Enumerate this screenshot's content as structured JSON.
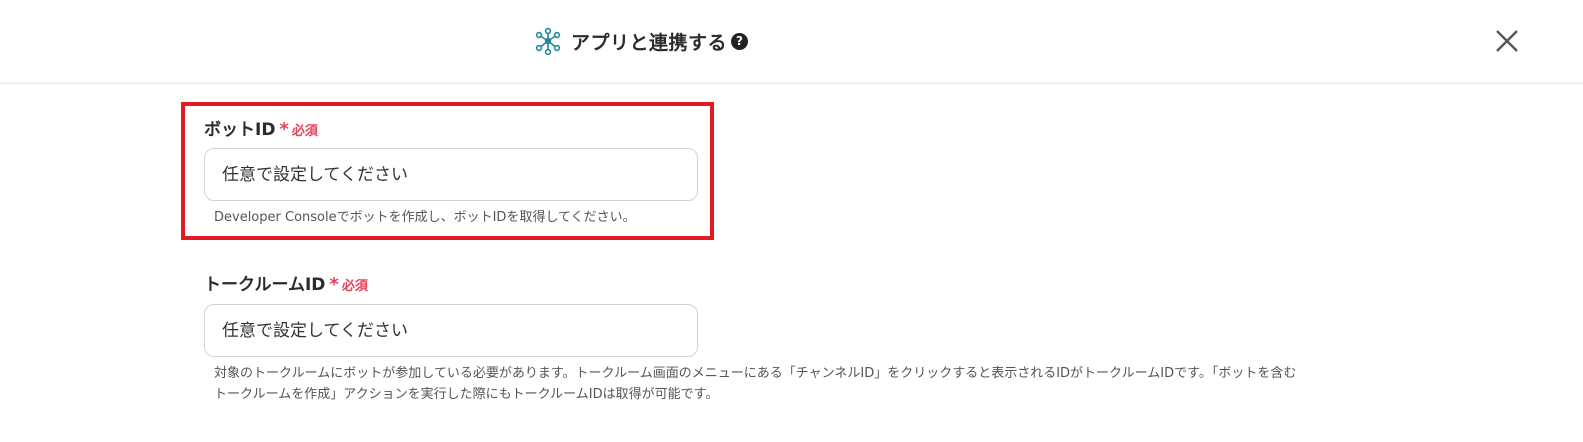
{
  "header": {
    "title": "アプリと連携する",
    "help_icon": "question-circle-icon",
    "close_icon": "close-x-icon"
  },
  "fields": [
    {
      "label": "ボットID",
      "required_mark": "*",
      "required_text": "必須",
      "placeholder": "任意で設定してください",
      "value": "",
      "help": "Developer Consoleでボットを作成し、ボットIDを取得してください。"
    },
    {
      "label": "トークルームID",
      "required_mark": "*",
      "required_text": "必須",
      "placeholder": "任意で設定してください",
      "value": "",
      "help_line1": "対象のトークルームにボットが参加している必要があります。トークルーム画面のメニューにある「チャンネルID」をクリックすると表示されるIDがトークルームIDです。「ボットを含む",
      "help_line2": "トークルームを作成」アクションを実行した際にもトークルームIDは取得が可能です。"
    }
  ],
  "colors": {
    "accent_icon": "#1e8a9a",
    "required": "#e8425a",
    "highlight_border": "#e01b24"
  }
}
